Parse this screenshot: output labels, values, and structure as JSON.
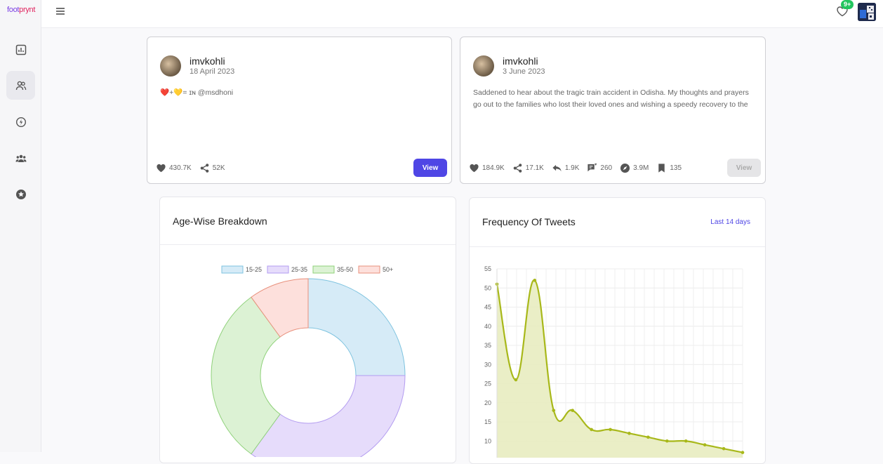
{
  "app": {
    "logo_a": "foot",
    "logo_b": "prynt",
    "notification_badge": "9+"
  },
  "posts": [
    {
      "author": "imvkohli",
      "date": "18 April 2023",
      "text": "❤️+💛= ɪɴ @msdhoni",
      "stats": [
        {
          "icon": "heart-icon",
          "value": "430.7K"
        },
        {
          "icon": "share-icon",
          "value": "52K"
        }
      ],
      "view_label": "View"
    },
    {
      "author": "imvkohli",
      "date": "3 June 2023",
      "text": "Saddened to hear about the tragic train accident in Odisha. My thoughts and prayers go out to the families who lost their loved ones and wishing a speedy recovery to the",
      "stats": [
        {
          "icon": "heart-icon",
          "value": "184.9K"
        },
        {
          "icon": "share-icon",
          "value": "17.1K"
        },
        {
          "icon": "reply-icon",
          "value": "1.9K"
        },
        {
          "icon": "quote-icon",
          "value": "260"
        },
        {
          "icon": "compass-icon",
          "value": "3.9M"
        },
        {
          "icon": "bookmark-icon",
          "value": "135"
        }
      ],
      "view_label": "View"
    }
  ],
  "age_chart": {
    "title": "Age-Wise Breakdown",
    "chart_data": {
      "type": "pie",
      "categories": [
        "15-25",
        "25-35",
        "35-50",
        "50+"
      ],
      "values": [
        25,
        35,
        30,
        10
      ],
      "colors": [
        "#d6ebf7",
        "#e6dcfb",
        "#dcf2d4",
        "#fde0dc"
      ],
      "borders": [
        "#7ec3df",
        "#b39cf0",
        "#8fd17a",
        "#e8907c"
      ]
    }
  },
  "freq_chart": {
    "title": "Frequency Of Tweets",
    "range_label": "Last 14 days",
    "chart_data": {
      "type": "area",
      "x": [
        1,
        2,
        3,
        4,
        5,
        6,
        7,
        8,
        9,
        10,
        11,
        12,
        13,
        14
      ],
      "values": [
        51,
        26,
        52,
        18,
        18,
        13,
        13,
        12,
        11,
        10,
        10,
        9,
        8,
        7
      ],
      "ylim": [
        10,
        55
      ],
      "yticks": [
        10,
        15,
        20,
        25,
        30,
        35,
        40,
        45,
        50,
        55
      ],
      "line_color": "#a8b81a",
      "fill_color": "#e8ecc0"
    }
  }
}
